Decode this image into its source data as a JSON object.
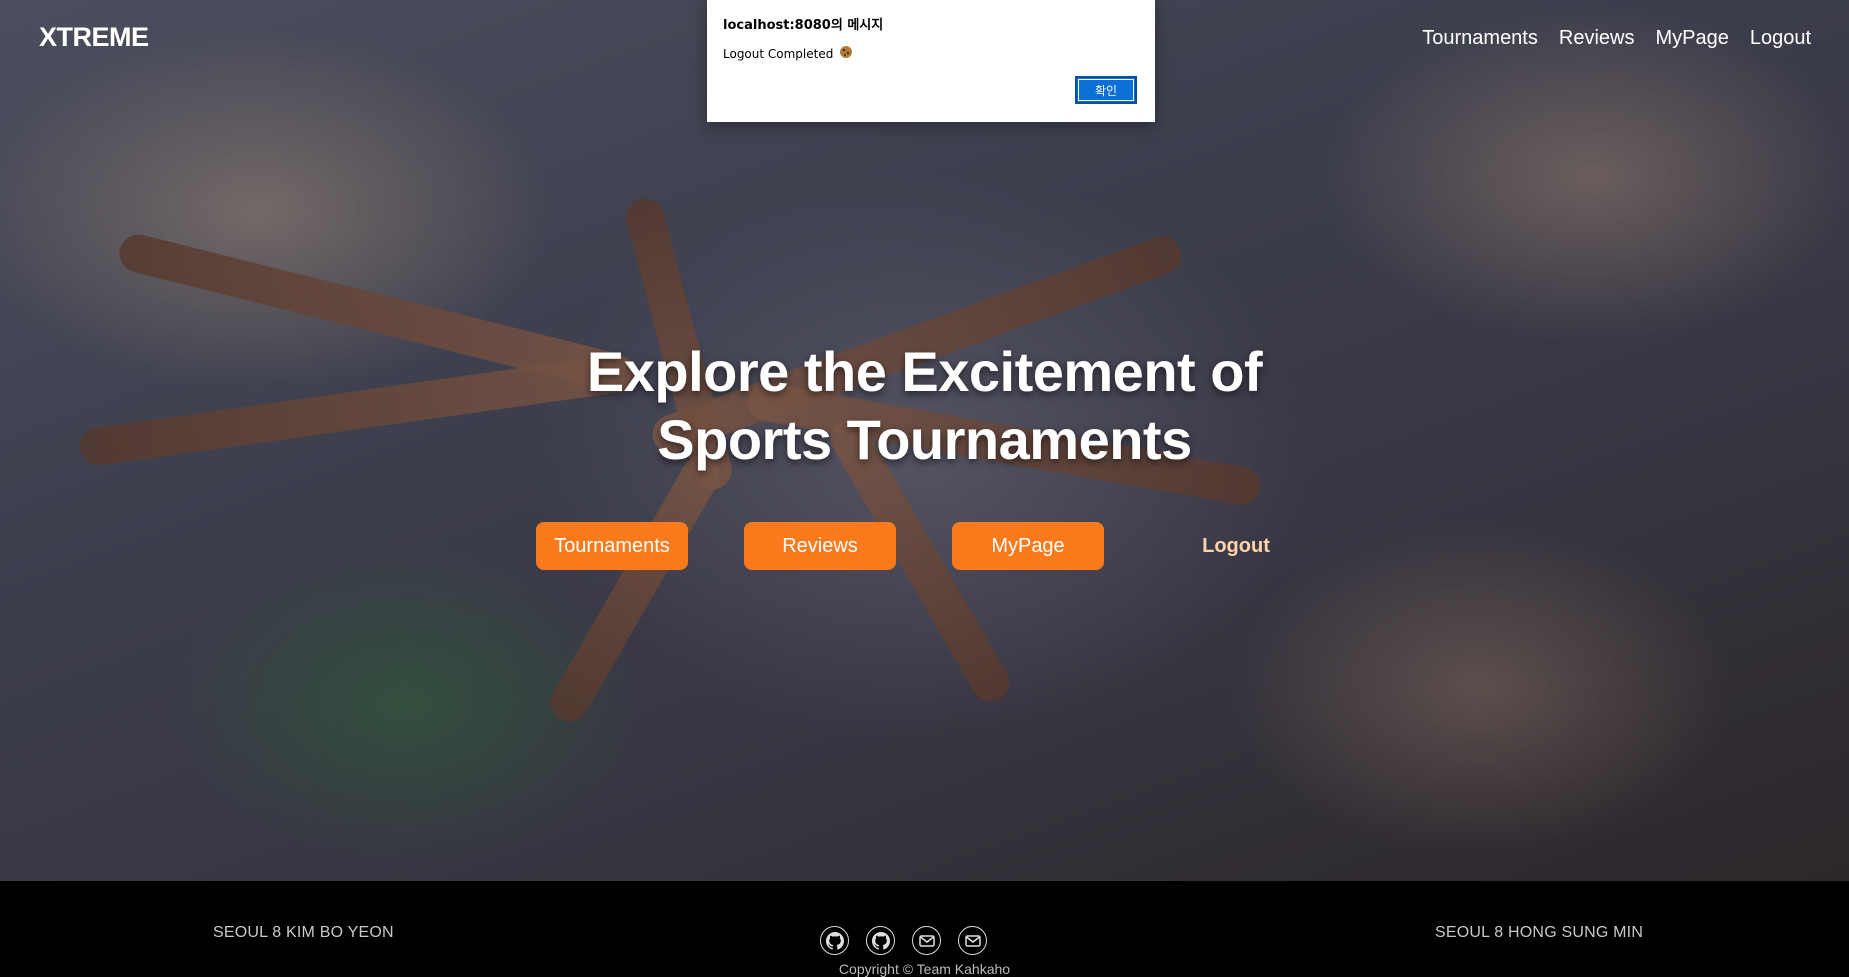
{
  "header": {
    "logo": "XTREME",
    "nav": [
      "Tournaments",
      "Reviews",
      "MyPage",
      "Logout"
    ]
  },
  "hero": {
    "headline_line1": "Explore the Excitement of",
    "headline_line2": "Sports Tournaments",
    "buttons": [
      "Tournaments",
      "Reviews",
      "MyPage"
    ],
    "logout_link": "Logout"
  },
  "footer": {
    "left_name": "SEOUL 8 KIM BO YEON",
    "right_name": "SEOUL 8 HONG SUNG MIN",
    "icons": [
      "github-icon",
      "github-icon",
      "mail-icon",
      "mail-icon"
    ],
    "copyright": "Copyright © Team Kahkaho"
  },
  "dialog": {
    "title": "localhost:8080의 메시지",
    "message": "Logout Completed",
    "message_icon": "cookie-icon",
    "ok_label": "확인"
  },
  "colors": {
    "accent": "#fb7a1b",
    "dialog_button": "#0b6fd6"
  }
}
